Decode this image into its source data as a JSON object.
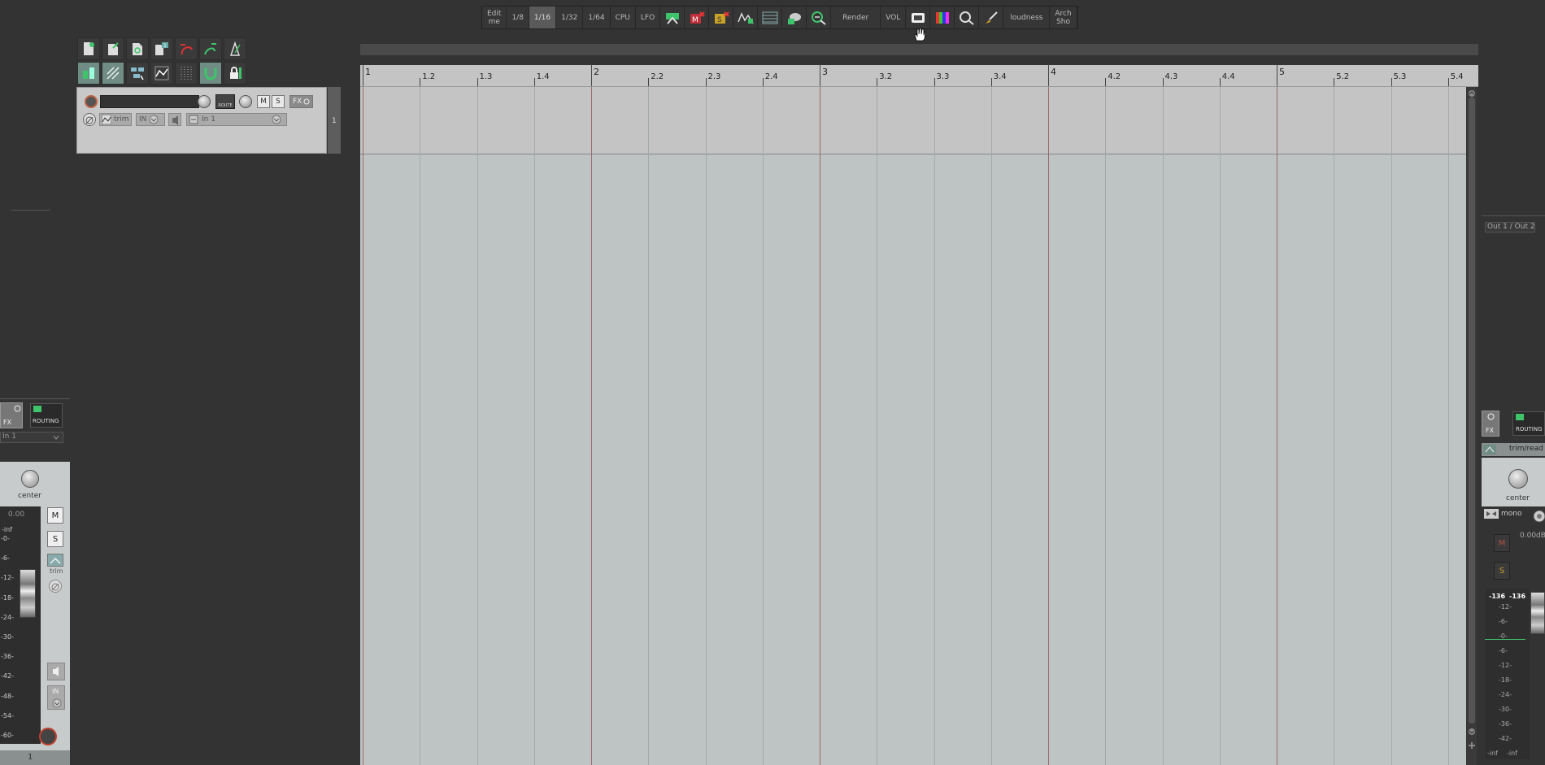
{
  "toolbar": {
    "items": [
      {
        "label": "Edit\nme",
        "lines": [
          "Edit",
          "me"
        ]
      },
      {
        "label": "1/8"
      },
      {
        "label": "1/16",
        "active": true
      },
      {
        "label": "1/32"
      },
      {
        "label": "1/64"
      },
      {
        "label": "CPU"
      },
      {
        "label": "LFO"
      }
    ],
    "render_label": "Render",
    "vol_label": "VOL",
    "loudness_label": "loudness",
    "arch_label_1": "Arch",
    "arch_label_2": "Sho"
  },
  "track": {
    "number": "1",
    "fx_label": "FX",
    "route_label": "ROUTE",
    "mute_label": "M",
    "solo_label": "S",
    "trim_label": "trim",
    "in_label": "IN",
    "input_label": "In 1"
  },
  "ruler": {
    "ticks": [
      {
        "label": "1",
        "bar": true
      },
      {
        "label": "1.2"
      },
      {
        "label": "1.3"
      },
      {
        "label": "1.4"
      },
      {
        "label": "2",
        "bar": true
      },
      {
        "label": "2.2"
      },
      {
        "label": "2.3"
      },
      {
        "label": "2.4"
      },
      {
        "label": "3",
        "bar": true
      },
      {
        "label": "3.2"
      },
      {
        "label": "3.3"
      },
      {
        "label": "3.4"
      },
      {
        "label": "4",
        "bar": true
      },
      {
        "label": "4.2"
      },
      {
        "label": "4.3"
      },
      {
        "label": "4.4"
      },
      {
        "label": "5",
        "bar": true
      },
      {
        "label": "5.2"
      },
      {
        "label": "5.3"
      },
      {
        "label": "5.4"
      }
    ]
  },
  "mixer_left": {
    "fx_label": "FX",
    "routing_label": "ROUTING",
    "input_label": "In 1",
    "pan_label": "center",
    "volume": "0.00",
    "peak": "-inf",
    "mute_label": "M",
    "solo_label": "S",
    "trim_label": "trim",
    "in_label": "IN",
    "track_number": "1",
    "scale": [
      "-0-",
      "-6-",
      "-12-",
      "-18-",
      "-24-",
      "-30-",
      "-36-",
      "-42-",
      "-48-",
      "-54-",
      "-60-"
    ]
  },
  "mixer_right": {
    "output_label": "Out 1 / Out 2",
    "fx_label": "FX",
    "routing_label": "ROUTING",
    "automation_label": "trim/read",
    "pan_label": "center",
    "mono_label": "mono",
    "volume": "0.00dB",
    "mute_label": "M",
    "solo_label": "S",
    "peak_left": "-136",
    "peak_right": "-136",
    "scale": [
      "-12-",
      "-6-",
      "-0-",
      "-6-",
      "-12-",
      "-18-",
      "-24-",
      "-30-",
      "-36-",
      "-42-"
    ],
    "bottom_left": "-inf",
    "bottom_right": "-inf"
  },
  "colors": {
    "accent_green": "#3ec46a",
    "record_red": "#bf4030",
    "active_tool": "#6f8d84"
  }
}
